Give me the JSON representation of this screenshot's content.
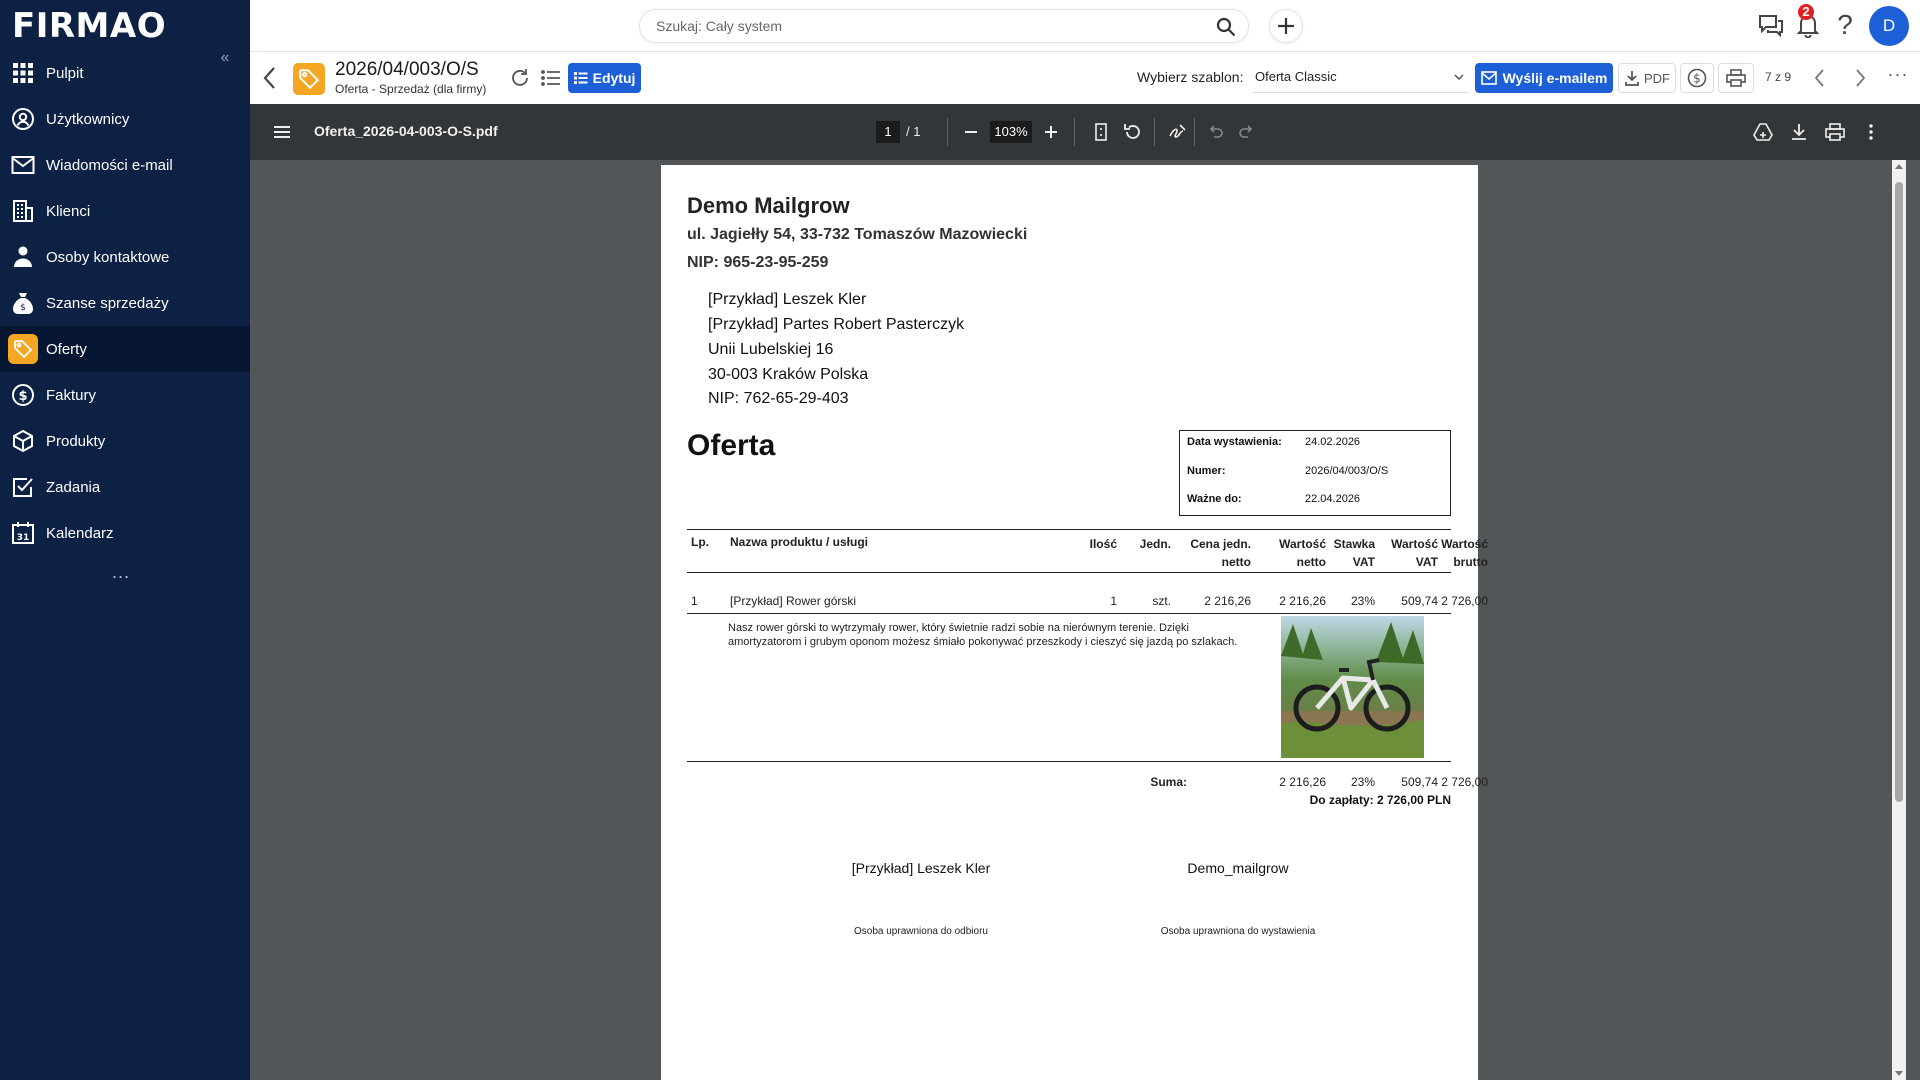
{
  "app": {
    "logo": "FIRMAO",
    "collapse": "«"
  },
  "sidebar": {
    "items": [
      {
        "label": "Pulpit",
        "icon": "grid-icon"
      },
      {
        "label": "Użytkownicy",
        "icon": "users-icon"
      },
      {
        "label": "Wiadomości e-mail",
        "icon": "mail-icon"
      },
      {
        "label": "Klienci",
        "icon": "building-icon"
      },
      {
        "label": "Osoby kontaktowe",
        "icon": "contacts-icon"
      },
      {
        "label": "Szanse sprzedaży",
        "icon": "money-bag-icon"
      },
      {
        "label": "Oferty",
        "icon": "offer-tag-icon",
        "active": true
      },
      {
        "label": "Faktury",
        "icon": "dollar-icon"
      },
      {
        "label": "Produkty",
        "icon": "box-icon"
      },
      {
        "label": "Zadania",
        "icon": "checkbox-icon"
      },
      {
        "label": "Kalendarz",
        "icon": "calendar-icon"
      }
    ],
    "more": "...",
    "calendar_day": "31"
  },
  "topbar": {
    "search_placeholder": "Szukaj: Cały system",
    "notifications_count": "2",
    "help": "?",
    "avatar_initial": "D"
  },
  "document_header": {
    "number": "2026/04/003/O/S",
    "type": "Oferta - Sprzedaż (dla firmy)",
    "edit_label": "Edytuj",
    "template_label": "Wybierz szablon:",
    "template_value": "Oferta Classic",
    "email_label": "Wyślij e-mailem",
    "pdf_label": "PDF",
    "pager": "7 z 9",
    "more": "···"
  },
  "pdf_viewer": {
    "filename": "Oferta_2026-04-003-O-S.pdf",
    "page_current": "1",
    "page_total": "/  1",
    "zoom": "103%"
  },
  "document": {
    "seller": {
      "name": "Demo Mailgrow",
      "address": "ul. Jagiełły 54, 33-732 Tomaszów Mazowiecki",
      "nip": "NIP: 965-23-95-259"
    },
    "buyer": {
      "lines": [
        "[Przykład]   Leszek Kler",
        "[Przykład] Partes Robert Pasterczyk",
        "Unii Lubelskiej 16",
        "30-003 Kraków Polska",
        "NIP: 762-65-29-403"
      ]
    },
    "title": "Oferta",
    "meta": {
      "issue_label": "Data wystawienia:",
      "issue_value": "24.02.2026",
      "number_label": "Numer:",
      "number_value": "2026/04/003/O/S",
      "valid_label": "Ważne do:",
      "valid_value": "22.04.2026"
    },
    "table": {
      "headers": {
        "lp": "Lp.",
        "name": "Nazwa produktu / usługi",
        "qty": "Ilość",
        "unit": "Jedn.",
        "unit_price": "Cena jedn.\nnetto",
        "net": "Wartość\nnetto",
        "vat_rate": "Stawka\nVAT",
        "vat_value": "Wartość\nVAT",
        "gross": "Wartość\nbrutto"
      },
      "rows": [
        {
          "lp": "1",
          "name": "[Przykład] Rower górski",
          "qty": "1",
          "unit": "szt.",
          "unit_price": "2 216,26",
          "net": "2 216,26",
          "vat_rate": "23%",
          "vat_value": "509,74",
          "gross": "2 726,00",
          "description": "Nasz rower górski to wytrzymały rower, który świetnie radzi sobie na nierównym terenie. Dzięki amortyzatorom i grubym oponom możesz śmiało pokonywać przeszkody i cieszyć się jazdą po szlakach."
        }
      ]
    },
    "summary": {
      "label": "Suma:",
      "net": "2 216,26",
      "vat_rate": "23%",
      "vat_value": "509,74",
      "gross": "2 726,00",
      "to_pay": "Do zapłaty: 2 726,00 PLN"
    },
    "signatures": {
      "left_name": "[Przykład]   Leszek Kler",
      "left_caption": "Osoba uprawniona do odbioru",
      "right_name": "Demo_mailgrow",
      "right_caption": "Osoba uprawniona do wystawienia"
    }
  },
  "colors": {
    "sidebar_bg": "#0d2145",
    "accent_blue": "#1d5fd6",
    "accent_orange": "#f5a623",
    "viewer_bg": "#525659",
    "viewer_toolbar": "#323639",
    "badge_red": "#e02020"
  }
}
